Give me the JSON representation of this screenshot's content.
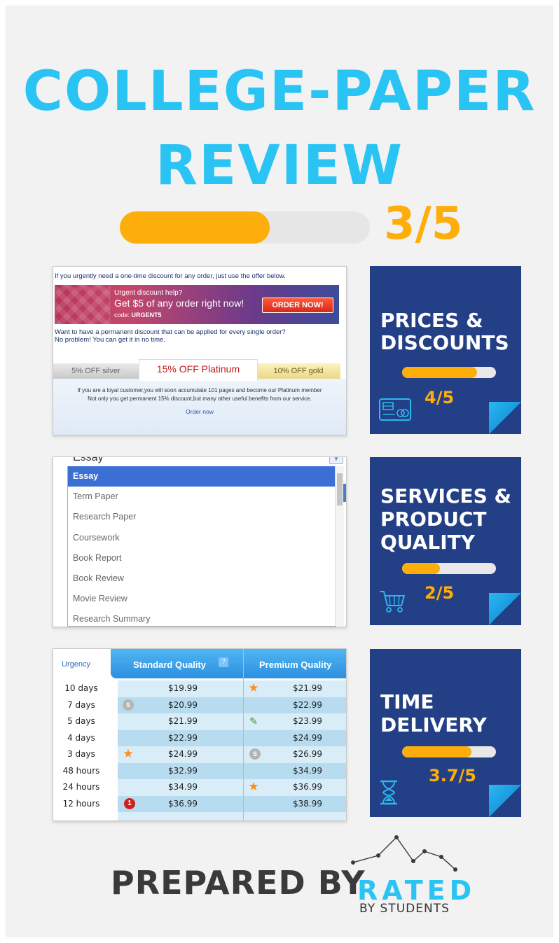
{
  "header": {
    "title_line1": "COLLEGE-PAPER",
    "title_line2": "REVIEW",
    "overall_score_text": "3/5",
    "overall_score": 3,
    "overall_max": 5
  },
  "colors": {
    "accent_blue": "#29c4f3",
    "accent_orange": "#fdae0b",
    "card_navy": "#233f85"
  },
  "discount_screenshot": {
    "intro": "If you urgently need a one-time discount for any order, just use the offer below.",
    "banner_line1": "Urgent discount help?",
    "banner_line2": "Get $5 of any order right now!",
    "banner_code_label": "code:",
    "banner_code": "URGENT5",
    "order_now_button": "ORDER NOW!",
    "permanent_line1": "Want to have a permanent discount that can be applied for every single order?",
    "permanent_line2": "No problem! You can get it in no time.",
    "tab_silver": "5% OFF silver",
    "tab_platinum": "15% OFF Platinum",
    "tab_gold": "10% OFF gold",
    "panel_line1": "If you are a loyal customer,you will soon accumulate 101 pages and become our Platinum member",
    "panel_line2": "Not only you get permanent 15% discount,but many other useful benefits from our service.",
    "order_link": "Order now"
  },
  "paper_type_screenshot": {
    "selected_value": "Essay",
    "options": [
      "Essay",
      "Term Paper",
      "Research Paper",
      "Coursework",
      "Book Report",
      "Book Review",
      "Movie Review",
      "Research Summary"
    ]
  },
  "price_table_screenshot": {
    "col_urgency": "Urgency",
    "col_standard": "Standard Quality",
    "col_premium": "Premium Quality",
    "help_badge": "?",
    "rows": [
      {
        "urgency": "10 days",
        "standard": "$19.99",
        "premium": "$21.99"
      },
      {
        "urgency": "7 days",
        "standard": "$20.99",
        "premium": "$22.99"
      },
      {
        "urgency": "5 days",
        "standard": "$21.99",
        "premium": "$23.99"
      },
      {
        "urgency": "4 days",
        "standard": "$22.99",
        "premium": "$24.99"
      },
      {
        "urgency": "3 days",
        "standard": "$24.99",
        "premium": "$26.99"
      },
      {
        "urgency": "48 hours",
        "standard": "$32.99",
        "premium": "$34.99"
      },
      {
        "urgency": "24 hours",
        "standard": "$34.99",
        "premium": "$36.99"
      },
      {
        "urgency": "12 hours",
        "standard": "$36.99",
        "premium": "$38.99"
      }
    ],
    "coin_letter": "S",
    "badge_number": "1"
  },
  "cards": [
    {
      "title_line1": "PRICES &",
      "title_line2": "DISCOUNTS",
      "score_text": "4/5",
      "score": 4,
      "icon": "credit-card-icon"
    },
    {
      "title_line1": "SERVICES &",
      "title_line2": "PRODUCT",
      "title_line3": "QUALITY",
      "score_text": "2/5",
      "score": 2,
      "icon": "shopping-cart-icon"
    },
    {
      "title_line1": "TIME",
      "title_line2": "DELIVERY",
      "score_text": "3.7/5",
      "score": 3.7,
      "icon": "hourglass-icon"
    }
  ],
  "footer": {
    "prepared_by": "PREPARED BY",
    "brand": "RATED",
    "brand_sub": "BY STUDENTS"
  }
}
